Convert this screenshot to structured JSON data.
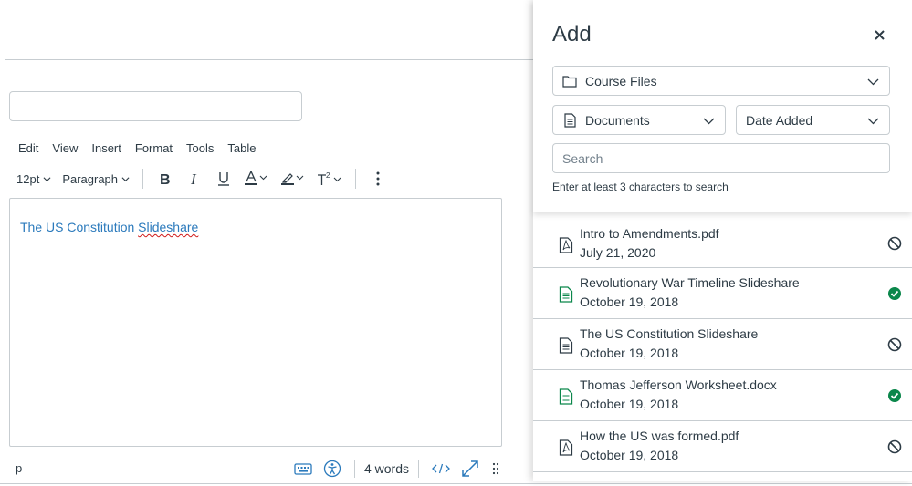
{
  "editor": {
    "menu": [
      "Edit",
      "View",
      "Insert",
      "Format",
      "Tools",
      "Table"
    ],
    "toolbar": {
      "font_size": "12pt",
      "block_format": "Paragraph",
      "icons": [
        "bold-icon",
        "italic-icon",
        "underline-icon",
        "text-color-icon",
        "highlight-color-icon",
        "superscript-icon",
        "more-options-icon"
      ]
    },
    "content": {
      "link_text_prefix": "The US Constitution ",
      "link_text_misspelled": "Slideshare"
    },
    "status": {
      "path": "p",
      "word_count": "4 words",
      "icons": [
        "keyboard-shortcuts-icon",
        "accessibility-checker-icon",
        "html-editor-icon",
        "fullscreen-icon",
        "resize-handle-icon"
      ]
    }
  },
  "tray": {
    "title": "Add",
    "content_type": "Course Files",
    "content_subtype": "Documents",
    "sort": "Date Added",
    "search_placeholder": "Search",
    "hint": "Enter at least 3 characters to search",
    "files": [
      {
        "name": "Intro to Amendments.pdf",
        "date": "July 21, 2020",
        "type": "pdf",
        "status": "unpublished"
      },
      {
        "name": "Revolutionary War Timeline Slideshare",
        "date": "October 19, 2018",
        "type": "doc-green",
        "status": "published"
      },
      {
        "name": "The US Constitution Slideshare",
        "date": "October 19, 2018",
        "type": "doc",
        "status": "unpublished"
      },
      {
        "name": "Thomas Jefferson Worksheet.docx",
        "date": "October 19, 2018",
        "type": "doc-green",
        "status": "published"
      },
      {
        "name": "How the US was formed.pdf",
        "date": "October 19, 2018",
        "type": "pdf",
        "status": "unpublished"
      }
    ]
  },
  "colors": {
    "link": "#2b7abc",
    "published": "#0b874b",
    "text": "#2d3b45",
    "border": "#c7cdd1",
    "doc_green": "#0b874b"
  }
}
